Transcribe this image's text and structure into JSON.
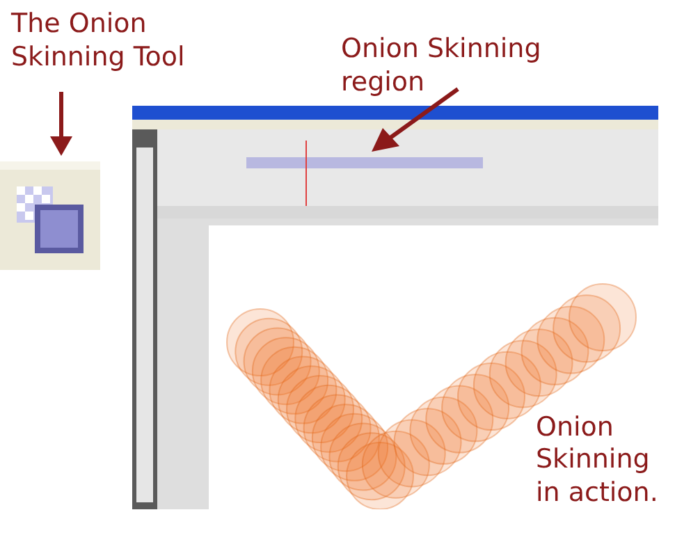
{
  "callouts": [
    {
      "text": "The Onion Skinning Tool"
    },
    {
      "text": "Onion Skinning region"
    },
    {
      "text": "Onion Skinning in action."
    }
  ]
}
